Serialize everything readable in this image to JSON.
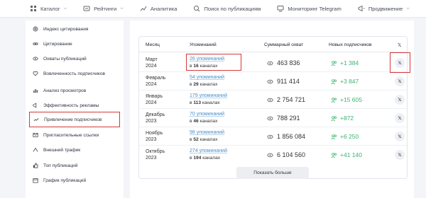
{
  "nav": {
    "items": [
      {
        "label": "Каталог",
        "icon": "grid-icon",
        "dropdown": true
      },
      {
        "label": "Рейтинги",
        "icon": "rating-icon",
        "dropdown": true
      },
      {
        "label": "Аналитика",
        "icon": "chart-icon",
        "dropdown": false
      },
      {
        "label": "Поиск по публикациям",
        "icon": "search-icon",
        "dropdown": false
      },
      {
        "label": "Мониторинг Telegram",
        "icon": "monitor-icon",
        "dropdown": false
      },
      {
        "label": "Продвижение",
        "icon": "megaphone-icon",
        "dropdown": true
      }
    ]
  },
  "sidebar": {
    "items": [
      {
        "label": "Индекс цитирования",
        "icon": "at-icon"
      },
      {
        "label": "Цитирование",
        "icon": "link-icon"
      },
      {
        "label": "Охваты публикаций",
        "icon": "eye-icon"
      },
      {
        "label": "Вовлеченность подписчиков",
        "icon": "heart-icon"
      },
      {
        "label": "Анализ просмотров",
        "icon": "bar-chart-icon"
      },
      {
        "label": "Эффективность рекламы",
        "icon": "ads-icon"
      },
      {
        "label": "Привлечение подписчиков",
        "icon": "trend-icon",
        "active": true
      },
      {
        "label": "Пригласительные ссылки",
        "icon": "invite-icon"
      },
      {
        "label": "Внешний трафик",
        "icon": "traffic-icon"
      },
      {
        "label": "Топ публикаций",
        "icon": "thumb-icon"
      },
      {
        "label": "График публикаций",
        "icon": "calendar-icon"
      }
    ]
  },
  "table": {
    "headers": {
      "month": "Месяц",
      "mentions": "Упоминаний",
      "reach": "Суммарный охват",
      "subs": "Новых подписчиков",
      "x": "𝕏"
    },
    "in_label": "в",
    "rows": [
      {
        "month": "Март",
        "year": "2024",
        "mentions": "26 упоминаний",
        "channels": "16",
        "channels_word": "каналах",
        "reach": "463 836",
        "subs": "+1 384"
      },
      {
        "month": "Февраль",
        "year": "2024",
        "mentions": "54 упоминаний",
        "channels": "29",
        "channels_word": "каналах",
        "reach": "911 414",
        "subs": "+3 847"
      },
      {
        "month": "Январь",
        "year": "2024",
        "mentions": "179 упоминаний",
        "channels": "113",
        "channels_word": "каналах",
        "reach": "2 754 721",
        "subs": "+15 605"
      },
      {
        "month": "Декабрь",
        "year": "2023",
        "mentions": "70 упоминаний",
        "channels": "46",
        "channels_word": "каналах",
        "reach": "788 291",
        "subs": "+872"
      },
      {
        "month": "Ноябрь",
        "year": "2023",
        "mentions": "98 упоминаний",
        "channels": "52",
        "channels_word": "каналах",
        "reach": "1 856 084",
        "subs": "+6 250"
      },
      {
        "month": "Октябрь",
        "year": "2023",
        "mentions": "274 упоминаний",
        "channels": "194",
        "channels_word": "каналах",
        "reach": "6 104 560",
        "subs": "+41 140"
      }
    ],
    "x_label": "𝕏"
  },
  "more_button": "Показать больше",
  "colors": {
    "accent": "#4a90c9",
    "positive": "#3cb371",
    "highlight": "#d33a3a"
  }
}
